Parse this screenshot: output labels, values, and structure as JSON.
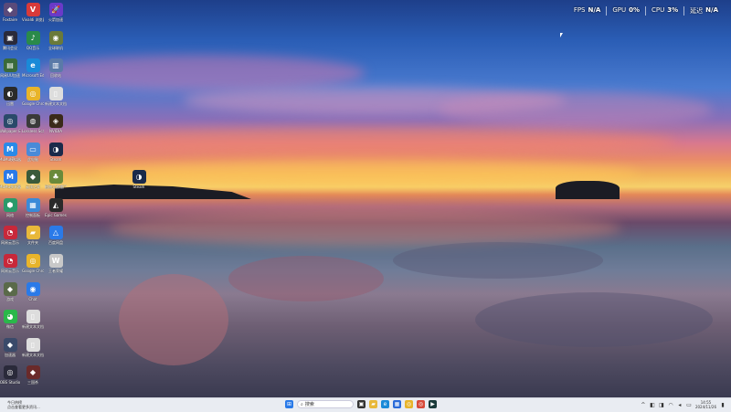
{
  "hud": {
    "fps_label": "FPS",
    "fps_value": "N/A",
    "gpu_label": "GPU",
    "gpu_value": "0%",
    "cpu_label": "CPU",
    "cpu_value": "3%",
    "latency_label": "延迟",
    "latency_value": "N/A"
  },
  "desktop_icons": [
    {
      "label": "Foxtaire",
      "glyph": "◆",
      "color": "#5a4a7a"
    },
    {
      "label": "Vivaldi 浏览器",
      "glyph": "V",
      "color": "#d83a3a"
    },
    {
      "label": "火箭加速",
      "glyph": "🚀",
      "color": "#6a3ac8"
    },
    {
      "label": "腾讯会议",
      "glyph": "▣",
      "color": "#2a2a3a"
    },
    {
      "label": "QQ音乐",
      "glyph": "♪",
      "color": "#2a8a4a"
    },
    {
      "label": "全球联机",
      "glyph": "◉",
      "color": "#6a7a3a"
    },
    {
      "label": "网易UU加速",
      "glyph": "▤",
      "color": "#3a6a3a"
    },
    {
      "label": "Microsoft Edge",
      "glyph": "e",
      "color": "#1a8ad8"
    },
    {
      "label": "回收站",
      "glyph": "▥",
      "color": "#5a7aa8"
    },
    {
      "label": "迅雷",
      "glyph": "◐",
      "color": "#2a2a2a"
    },
    {
      "label": "Google Chrome",
      "glyph": "◎",
      "color": "#e8b42a"
    },
    {
      "label": "新建文本文档",
      "glyph": "▯",
      "color": "#dddddd"
    },
    {
      "label": "Wallpaper Engine",
      "glyph": "◎",
      "color": "#2a4a6a"
    },
    {
      "label": "Lossless Scaling",
      "glyph": "◍",
      "color": "#3a3a3a"
    },
    {
      "label": "NVIDIA",
      "glyph": "◈",
      "color": "#3a2a1a"
    },
    {
      "label": "MuMu模拟器",
      "glyph": "M",
      "color": "#2a8ae8"
    },
    {
      "label": "此电脑",
      "glyph": "▭",
      "color": "#4a8ad8"
    },
    {
      "label": "Steam",
      "glyph": "◑",
      "color": "#1a2a4a"
    },
    {
      "label": "MuMu多开器",
      "glyph": "M",
      "color": "#2a7ae8"
    },
    {
      "label": "云顶之弈",
      "glyph": "◆",
      "color": "#3a5a3a"
    },
    {
      "label": "植物大战僵尸",
      "glyph": "♣",
      "color": "#6a8a3a"
    },
    {
      "label": "网络",
      "glyph": "⬢",
      "color": "#2a9a6a"
    },
    {
      "label": "控制面板",
      "glyph": "▦",
      "color": "#3a8ad8"
    },
    {
      "label": "Epic Games",
      "glyph": "◭",
      "color": "#2a2a2a"
    },
    {
      "label": "网易云音乐",
      "glyph": "◔",
      "color": "#c8283a"
    },
    {
      "label": "文件夹",
      "glyph": "▰",
      "color": "#e8b83a"
    },
    {
      "label": "百度网盘",
      "glyph": "△",
      "color": "#2a7ae8"
    },
    {
      "label": "网易云音乐",
      "glyph": "◔",
      "color": "#c8283a"
    },
    {
      "label": "Google Chrome",
      "glyph": "◎",
      "color": "#e8b42a"
    },
    {
      "label": "王者荣耀",
      "glyph": "W",
      "color": "#c8c8c8"
    },
    {
      "label": "游戏",
      "glyph": "◆",
      "color": "#5a6a4a"
    },
    {
      "label": "Chat",
      "glyph": "◉",
      "color": "#2a7ae8"
    },
    {
      "label": "微信",
      "glyph": "◕",
      "color": "#2ab84a"
    },
    {
      "label": "新建文本文档",
      "glyph": "▯",
      "color": "#dddddd"
    },
    {
      "label": "加速器",
      "glyph": "◆",
      "color": "#3a4a6a"
    },
    {
      "label": "新建文本文档",
      "glyph": "▯",
      "color": "#dddddd"
    },
    {
      "label": "OBS Studio",
      "glyph": "◎",
      "color": "#2a2a3a"
    },
    {
      "label": "三国杀",
      "glyph": "◆",
      "color": "#6a2a2a"
    },
    {
      "label": "Steam",
      "glyph": "◑",
      "color": "#1a2a4a"
    }
  ],
  "taskbar": {
    "status_line1": "今日热榜",
    "status_line2": "点击查看更多资讯...",
    "search_placeholder": "搜索",
    "clock_time": "14:55",
    "clock_date": "2024/11/26"
  }
}
